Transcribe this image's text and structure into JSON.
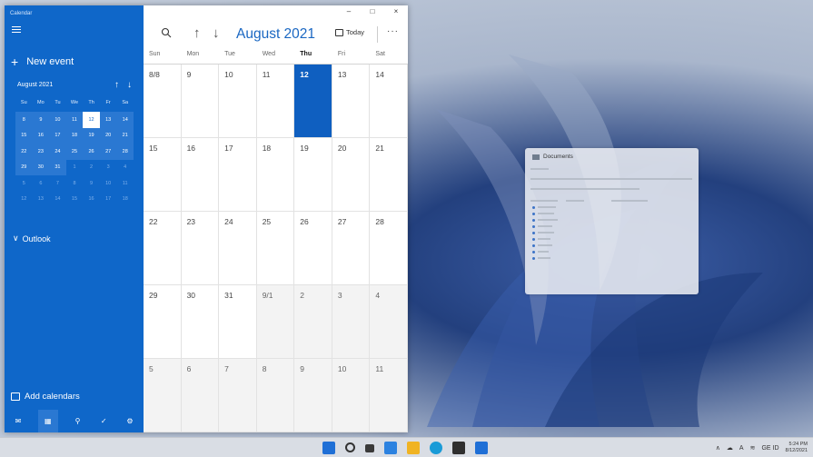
{
  "calendar_app": {
    "app_title": "Calendar",
    "new_event_label": "New event",
    "mini_calendar": {
      "month_label": "August 2021",
      "weekdays": [
        "Su",
        "Mo",
        "Tu",
        "We",
        "Th",
        "Fr",
        "Sa"
      ],
      "days": [
        [
          "1",
          "2",
          "3",
          "4",
          "5",
          "6",
          "7"
        ],
        [
          "8",
          "9",
          "10",
          "11",
          "12",
          "13",
          "14"
        ],
        [
          "15",
          "16",
          "17",
          "18",
          "19",
          "20",
          "21"
        ],
        [
          "22",
          "23",
          "24",
          "25",
          "26",
          "27",
          "28"
        ],
        [
          "29",
          "30",
          "31",
          "1",
          "2",
          "3",
          "4"
        ],
        [
          "5",
          "6",
          "7",
          "8",
          "9",
          "10",
          "11"
        ],
        [
          "12",
          "13",
          "14",
          "15",
          "16",
          "17",
          "18"
        ]
      ],
      "selected_day": "12"
    },
    "outlook_label": "Outlook",
    "add_calendars_label": "Add calendars",
    "toolbar": {
      "month_title": "August 2021",
      "today_label": "Today",
      "more_label": "···"
    },
    "window_controls": {
      "minimize": "–",
      "maximize": "□",
      "close": "×"
    },
    "month_view": {
      "weekdays": [
        "Sun",
        "Mon",
        "Tue",
        "Wed",
        "Thu",
        "Fri",
        "Sat"
      ],
      "current_weekday": "Thu",
      "weeks": [
        [
          "8/8",
          "9",
          "10",
          "11",
          "12",
          "13",
          "14"
        ],
        [
          "15",
          "16",
          "17",
          "18",
          "19",
          "20",
          "21"
        ],
        [
          "22",
          "23",
          "24",
          "25",
          "26",
          "27",
          "28"
        ],
        [
          "29",
          "30",
          "31",
          "9/1",
          "2",
          "3",
          "4"
        ],
        [
          "5",
          "6",
          "7",
          "8",
          "9",
          "10",
          "11"
        ]
      ],
      "today": "12"
    }
  },
  "documents_window": {
    "title": "Documents"
  },
  "taskbar": {
    "clock_time": "5:24 PM",
    "clock_date": "8/12/2021",
    "tray_lang": "A",
    "tray_network": "GE ID"
  },
  "colors": {
    "accent": "#0f67c9",
    "today_cell": "#0f5fc0"
  }
}
